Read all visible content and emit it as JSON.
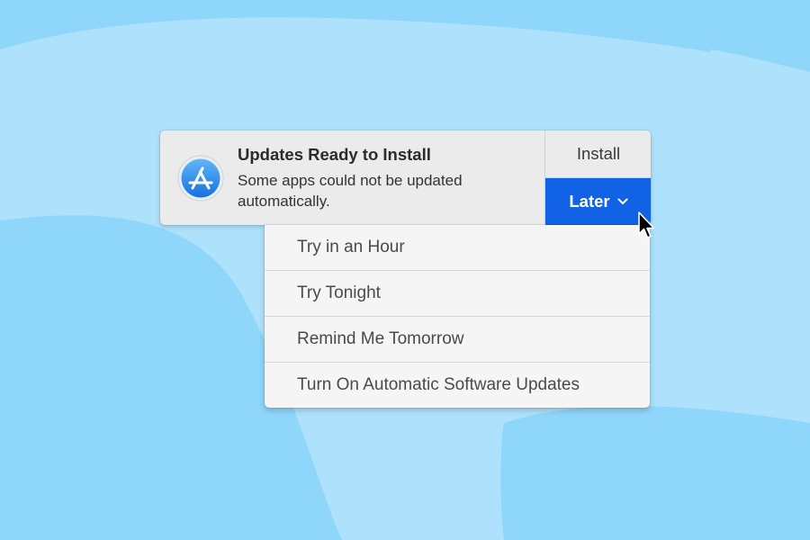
{
  "notification": {
    "app_icon": "app-store-icon",
    "title": "Updates Ready to Install",
    "body_line1": "Some apps could not be updated",
    "body_line2": "automatically.",
    "install_label": "Install",
    "later_label": "Later",
    "later_icon": "chevron-down-icon"
  },
  "menu": {
    "items": [
      {
        "label": "Try in an Hour"
      },
      {
        "label": "Try Tonight"
      },
      {
        "label": "Remind Me Tomorrow"
      },
      {
        "label": "Turn On Automatic Software Updates"
      }
    ]
  },
  "colors": {
    "background": "#8fd6fb",
    "background_light": "#aee2fc",
    "accent": "#1262e6"
  },
  "cursor": "arrow-pointer-icon"
}
